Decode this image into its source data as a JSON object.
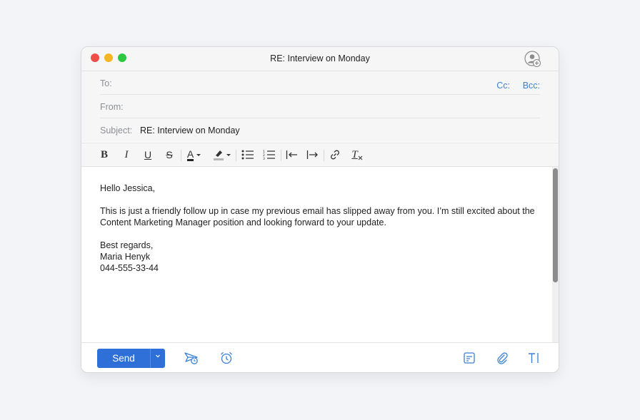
{
  "window": {
    "title": "RE: Interview on Monday"
  },
  "headers": {
    "to_label": "To:",
    "from_label": "From:",
    "subject_label": "Subject:",
    "subject_value": "RE: Interview on Monday",
    "cc_label": "Cc:",
    "bcc_label": "Bcc:"
  },
  "toolbar": {
    "bold": "B",
    "italic": "I",
    "underline": "U",
    "strike": "S",
    "text_color": "A",
    "clear_format": "T"
  },
  "message": {
    "greeting": "Hello Jessica,",
    "body": "This is just a friendly follow up in case my previous email has slipped away from you. I’m still excited about the Content Marketing Manager position and looking forward to your update.",
    "closing": "Best regards,",
    "name": "Maria Henyk",
    "phone": "044-555-33-44"
  },
  "footer": {
    "send_label": "Send"
  },
  "colors": {
    "accent": "#2f6fd8",
    "link": "#3b7fd6",
    "close": "#ee4f48",
    "minimize": "#f5b526",
    "zoom": "#2dc740"
  },
  "icons": [
    "add-contact-icon",
    "bold-icon",
    "italic-icon",
    "underline-icon",
    "strikethrough-icon",
    "text-color-icon",
    "highlight-icon",
    "bullet-list-icon",
    "numbered-list-icon",
    "outdent-icon",
    "indent-icon",
    "link-icon",
    "clear-format-icon",
    "send-later-icon",
    "reminder-icon",
    "template-icon",
    "attachment-icon",
    "font-size-icon"
  ]
}
